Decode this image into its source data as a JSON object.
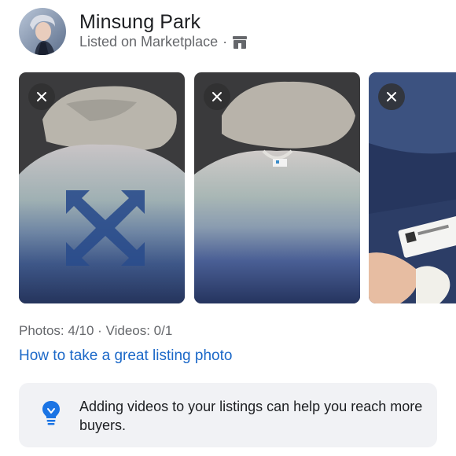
{
  "seller": {
    "name": "Minsung Park",
    "listing_context": "Listed on Marketplace",
    "separator": "·",
    "context_icon": "store-icon"
  },
  "photos": {
    "items": [
      {
        "label": "sweater-flat-with-arrow-logo",
        "remove_icon": "close-icon"
      },
      {
        "label": "sweater-flat-gradient",
        "remove_icon": "close-icon"
      },
      {
        "label": "sweater-tag-closeup",
        "remove_icon": "close-icon"
      }
    ]
  },
  "counts": {
    "text": "Photos: 4/10 · Videos: 0/1"
  },
  "help_link": {
    "text": "How to take a great listing photo"
  },
  "tip": {
    "icon": "lightbulb-icon",
    "text": "Adding videos to your listings can help you reach more buyers."
  },
  "colors": {
    "link": "#1b68c8",
    "secondary_text": "#65676b",
    "tip_background": "#f1f2f5",
    "tip_icon": "#1b74e4"
  }
}
